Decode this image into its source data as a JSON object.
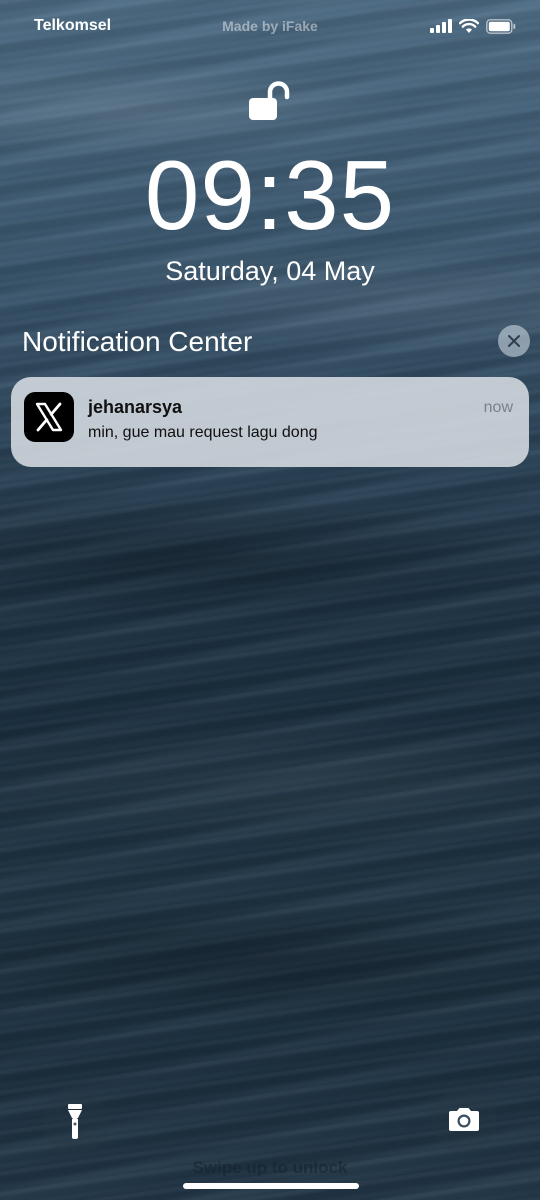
{
  "status_bar": {
    "carrier": "Telkomsel",
    "watermark": "Made by iFake",
    "icons": [
      "cellular-signal-icon",
      "wifi-icon",
      "battery-icon"
    ]
  },
  "lock": {
    "icon": "unlocked-padlock-icon",
    "time": "09:35",
    "date": "Saturday, 04 May"
  },
  "notification_center": {
    "title": "Notification Center",
    "close_icon": "close-icon"
  },
  "notifications": [
    {
      "app_icon": "x-logo-icon",
      "sender": "jehanarsya",
      "time": "now",
      "message": "min, gue mau request lagu dong"
    }
  ],
  "bottom": {
    "flashlight_icon": "flashlight-icon",
    "camera_icon": "camera-icon",
    "swipe_hint": "Swipe up to unlock"
  },
  "colors": {
    "notification_bg": "#d6dce2",
    "app_icon_bg": "#000000",
    "text_primary": "#ffffff"
  }
}
